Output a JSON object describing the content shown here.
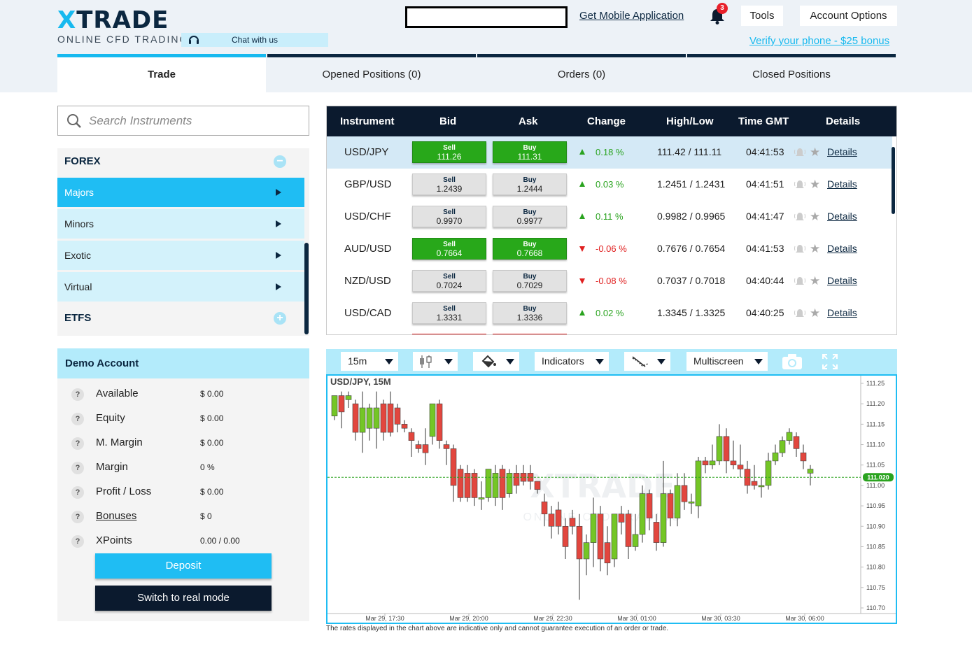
{
  "header": {
    "logo_text": "XTRADE",
    "logo_sub": "ONLINE CFD TRADING",
    "chat_label": "Chat with us",
    "mobile_link": "Get Mobile Application",
    "notification_count": "3",
    "tools_label": "Tools",
    "account_options_label": "Account Options",
    "verify_link": "Verify your phone - $25 bonus"
  },
  "tabs": [
    {
      "label": "Trade",
      "active": true
    },
    {
      "label": "Opened Positions (0)",
      "active": false
    },
    {
      "label": "Orders (0)",
      "active": false
    },
    {
      "label": "Closed Positions",
      "active": false
    }
  ],
  "search": {
    "placeholder": "Search Instruments"
  },
  "categories": {
    "forex": {
      "label": "FOREX",
      "toggle": "−"
    },
    "subs": [
      {
        "label": "Majors",
        "active": true
      },
      {
        "label": "Minors",
        "active": false
      },
      {
        "label": "Exotic",
        "active": false
      },
      {
        "label": "Virtual",
        "active": false
      }
    ],
    "etfs": {
      "label": "ETFS",
      "toggle": "+"
    }
  },
  "account": {
    "title": "Demo Account",
    "rows": [
      {
        "label": "Available",
        "value": "$ 0.00"
      },
      {
        "label": "Equity",
        "value": "$ 0.00"
      },
      {
        "label": "M. Margin",
        "value": "$ 0.00"
      },
      {
        "label": "Margin",
        "value": "0 %"
      },
      {
        "label": "Profit / Loss",
        "value": "$ 0.00"
      },
      {
        "label": "Bonuses",
        "value": "$ 0"
      },
      {
        "label": "XPoints",
        "value": "0.00 / 0.00"
      }
    ],
    "deposit_label": "Deposit",
    "switch_label": "Switch to real mode"
  },
  "table": {
    "headers": [
      "Instrument",
      "Bid",
      "Ask",
      "Change",
      "High/Low",
      "Time GMT",
      "Details"
    ],
    "sell_label": "Sell",
    "buy_label": "Buy",
    "details_label": "Details",
    "rows": [
      {
        "instrument": "USD/JPY",
        "bid": "111.26",
        "ask": "111.31",
        "change": "0.18 %",
        "dir": "up",
        "highlow": "111.42 / 111.11",
        "time": "04:41:53",
        "green": true,
        "selected": true
      },
      {
        "instrument": "GBP/USD",
        "bid": "1.2439",
        "ask": "1.2444",
        "change": "0.03 %",
        "dir": "up",
        "highlow": "1.2451 / 1.2431",
        "time": "04:41:51",
        "green": false,
        "selected": false
      },
      {
        "instrument": "USD/CHF",
        "bid": "0.9970",
        "ask": "0.9977",
        "change": "0.11 %",
        "dir": "up",
        "highlow": "0.9982 / 0.9965",
        "time": "04:41:47",
        "green": false,
        "selected": false
      },
      {
        "instrument": "AUD/USD",
        "bid": "0.7664",
        "ask": "0.7668",
        "change": "-0.06 %",
        "dir": "down",
        "highlow": "0.7676 / 0.7654",
        "time": "04:41:53",
        "green": true,
        "selected": false
      },
      {
        "instrument": "NZD/USD",
        "bid": "0.7024",
        "ask": "0.7029",
        "change": "-0.08 %",
        "dir": "down",
        "highlow": "0.7037 / 0.7018",
        "time": "04:40:44",
        "green": false,
        "selected": false
      },
      {
        "instrument": "USD/CAD",
        "bid": "1.3331",
        "ask": "1.3336",
        "change": "0.02 %",
        "dir": "up",
        "highlow": "1.3345 / 1.3325",
        "time": "04:40:25",
        "green": false,
        "selected": false
      }
    ]
  },
  "chart_toolbar": {
    "timeframe": "15m",
    "indicators": "Indicators",
    "multiscreen": "Multiscreen"
  },
  "chart_data": {
    "type": "candlestick",
    "title": "USD/JPY, 15M",
    "watermark": "XTRADE",
    "watermark_sub": "ONLINE CFD TRADING",
    "current_price": "111.020",
    "current_value": 111.02,
    "ylim": [
      110.7,
      111.25
    ],
    "y_ticks": [
      "111.25",
      "111.20",
      "111.15",
      "111.10",
      "111.05",
      "111.00",
      "110.95",
      "110.90",
      "110.85",
      "110.80",
      "110.75",
      "110.70"
    ],
    "x_ticks": [
      "Mar 29, 17:30",
      "Mar 29, 20:00",
      "Mar 29, 22:30",
      "Mar 30, 01:00",
      "Mar 30, 03:30",
      "Mar 30, 06:00"
    ],
    "candles": [
      [
        111.17,
        111.22,
        111.17,
        111.16
      ],
      [
        111.22,
        111.18,
        111.23,
        111.14
      ],
      [
        111.21,
        111.22,
        111.23,
        111.19
      ],
      [
        111.2,
        111.13,
        111.21,
        111.11
      ],
      [
        111.13,
        111.19,
        111.23,
        111.08
      ],
      [
        111.14,
        111.19,
        111.2,
        111.11
      ],
      [
        111.14,
        111.19,
        111.23,
        111.09
      ],
      [
        111.2,
        111.13,
        111.21,
        111.11
      ],
      [
        111.2,
        111.13,
        111.23,
        111.12
      ],
      [
        111.19,
        111.15,
        111.2,
        111.13
      ],
      [
        111.15,
        111.14,
        111.16,
        111.13
      ],
      [
        111.13,
        111.11,
        111.14,
        111.07
      ],
      [
        111.1,
        111.09,
        111.11,
        111.08
      ],
      [
        111.1,
        111.08,
        111.14,
        111.05
      ],
      [
        111.12,
        111.2,
        111.2,
        111.1
      ],
      [
        111.2,
        111.11,
        111.21,
        111.09
      ],
      [
        111.1,
        111.09,
        111.11,
        111.05
      ],
      [
        111.09,
        111.0,
        111.1,
        110.96
      ],
      [
        111.04,
        110.97,
        111.05,
        110.96
      ],
      [
        111.03,
        110.97,
        111.05,
        110.96
      ],
      [
        111.03,
        110.97,
        111.04,
        110.95
      ],
      [
        110.97,
        110.97,
        111.01,
        110.94
      ],
      [
        110.97,
        111.04,
        111.04,
        110.96
      ],
      [
        110.97,
        111.03,
        111.05,
        110.95
      ],
      [
        111.04,
        110.97,
        111.05,
        110.94
      ],
      [
        110.98,
        111.03,
        111.04,
        110.97
      ],
      [
        111.03,
        111.0,
        111.05,
        110.98
      ],
      [
        111.03,
        111.01,
        111.05,
        111.0
      ],
      [
        111.03,
        111.01,
        111.05,
        110.99
      ],
      [
        111.01,
        110.99,
        111.01,
        110.98
      ],
      [
        110.96,
        110.93,
        110.98,
        110.9
      ],
      [
        110.93,
        110.9,
        110.95,
        110.87
      ],
      [
        110.94,
        110.9,
        110.96,
        110.88
      ],
      [
        110.9,
        110.85,
        110.92,
        110.82
      ],
      [
        110.92,
        110.9,
        110.94,
        110.88
      ],
      [
        110.9,
        110.82,
        110.93,
        110.72
      ],
      [
        110.82,
        110.86,
        110.88,
        110.78
      ],
      [
        110.86,
        110.93,
        110.97,
        110.8
      ],
      [
        110.93,
        110.82,
        110.95,
        110.79
      ],
      [
        110.86,
        110.81,
        110.9,
        110.78
      ],
      [
        110.82,
        110.93,
        110.93,
        110.8
      ],
      [
        110.93,
        110.91,
        110.95,
        110.88
      ],
      [
        110.93,
        110.85,
        110.94,
        110.82
      ],
      [
        110.85,
        110.88,
        110.93,
        110.84
      ],
      [
        110.88,
        110.98,
        111.0,
        110.86
      ],
      [
        110.98,
        110.92,
        110.99,
        110.89
      ],
      [
        110.91,
        110.86,
        110.93,
        110.84
      ],
      [
        110.86,
        110.98,
        111.06,
        110.85
      ],
      [
        110.98,
        110.92,
        110.99,
        110.9
      ],
      [
        110.92,
        111.0,
        111.03,
        110.9
      ],
      [
        111.0,
        110.96,
        111.03,
        110.94
      ],
      [
        110.96,
        110.96,
        110.98,
        110.93
      ],
      [
        110.95,
        111.06,
        111.07,
        110.92
      ],
      [
        111.06,
        111.05,
        111.07,
        111.03
      ],
      [
        111.05,
        111.06,
        111.1,
        111.04
      ],
      [
        111.06,
        111.12,
        111.15,
        111.05
      ],
      [
        111.12,
        111.06,
        111.14,
        111.03
      ],
      [
        111.06,
        111.05,
        111.11,
        111.04
      ],
      [
        111.05,
        111.04,
        111.1,
        111.02
      ],
      [
        111.04,
        111.0,
        111.06,
        110.98
      ],
      [
        111.01,
        111.0,
        111.05,
        110.99
      ],
      [
        111.0,
        111.0,
        111.02,
        110.97
      ],
      [
        111.0,
        111.06,
        111.08,
        110.99
      ],
      [
        111.06,
        111.08,
        111.1,
        111.05
      ],
      [
        111.08,
        111.11,
        111.12,
        111.07
      ],
      [
        111.11,
        111.13,
        111.14,
        111.1
      ],
      [
        111.12,
        111.09,
        111.13,
        111.07
      ],
      [
        111.08,
        111.06,
        111.1,
        111.04
      ],
      [
        111.03,
        111.04,
        111.05,
        111.0
      ]
    ]
  },
  "disclaimer": "The rates displayed in the chart above are indicative only and cannot guarantee execution of an order or trade."
}
